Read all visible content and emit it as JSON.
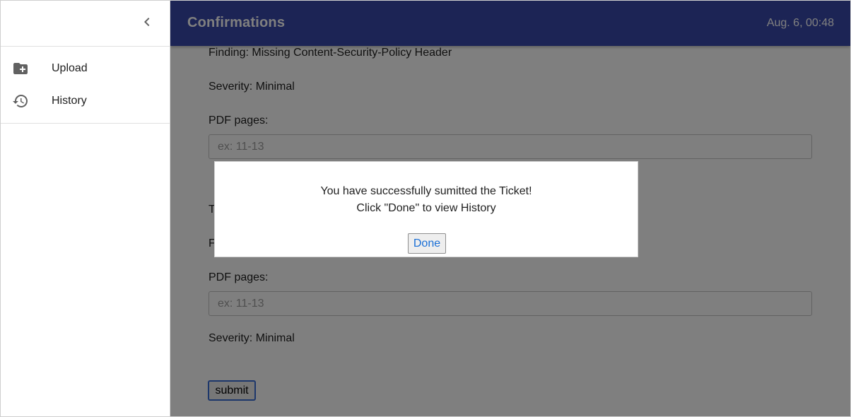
{
  "sidebar": {
    "collapse_icon": "chevron-left-icon",
    "items": [
      {
        "label": "Upload",
        "icon": "folder-add-icon"
      },
      {
        "label": "History",
        "icon": "history-icon"
      }
    ]
  },
  "header": {
    "title": "Confirmations",
    "timestamp": "Aug. 6, 00:48",
    "color": "#3949ab"
  },
  "main": {
    "finding_1": "Finding: Missing Content-Security-Policy Header",
    "severity_1": "Severity: Minimal",
    "pdf_pages_label_1": "PDF pages:",
    "pdf_pages_placeholder_1": "ex: 11-13",
    "partial_text_t": "T",
    "partial_text_f": "F",
    "pdf_pages_label_2": "PDF pages:",
    "pdf_pages_placeholder_2": "ex: 11-13",
    "severity_2": "Severity: Minimal",
    "submit_label": "submit"
  },
  "modal": {
    "line1": "You have successfully sumitted the Ticket!",
    "line2": "Click \"Done\" to view History",
    "done_label": "Done"
  }
}
